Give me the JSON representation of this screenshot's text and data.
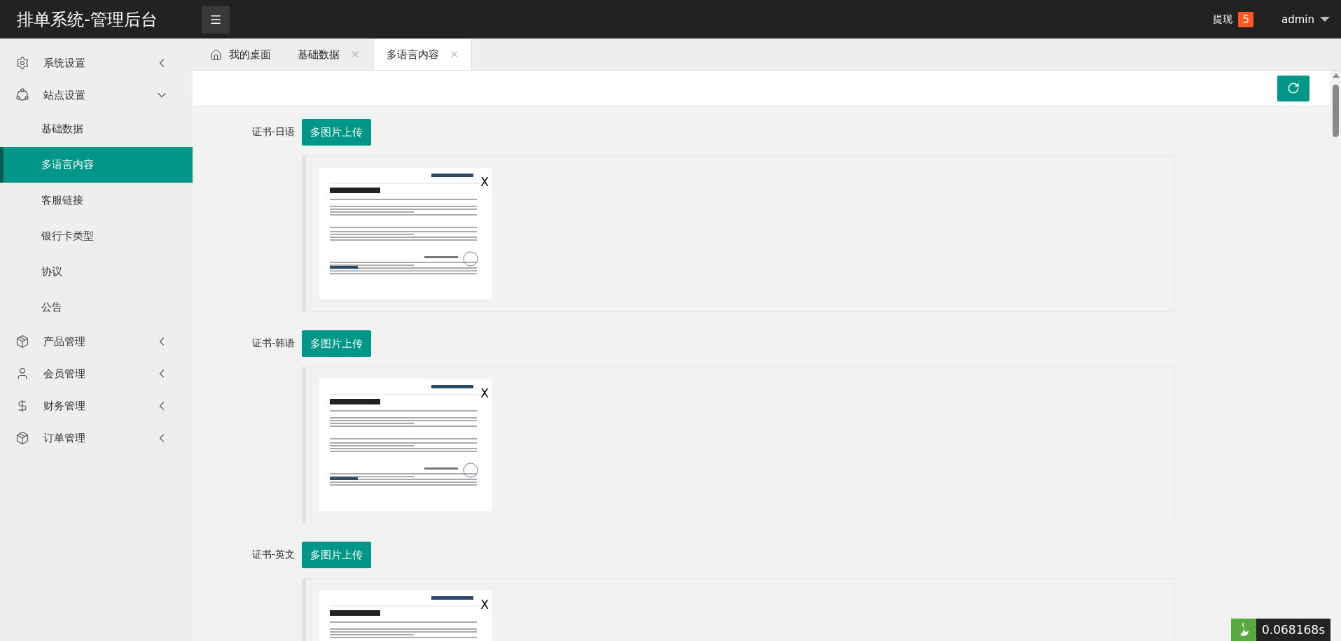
{
  "header": {
    "title": "排单系统-管理后台",
    "withdraw_label": "提现",
    "withdraw_count": "5",
    "user": "admin"
  },
  "sidebar": {
    "items": [
      {
        "label": "系统设置",
        "expanded": false
      },
      {
        "label": "站点设置",
        "expanded": true,
        "children": [
          {
            "label": "基础数据",
            "selected": false
          },
          {
            "label": "多语言内容",
            "selected": true
          },
          {
            "label": "客服链接",
            "selected": false
          },
          {
            "label": "银行卡类型",
            "selected": false
          },
          {
            "label": "协议",
            "selected": false
          },
          {
            "label": "公告",
            "selected": false
          }
        ]
      },
      {
        "label": "产品管理",
        "expanded": false
      },
      {
        "label": "会员管理",
        "expanded": false
      },
      {
        "label": "财务管理",
        "expanded": false
      },
      {
        "label": "订单管理",
        "expanded": false
      }
    ]
  },
  "tabs": [
    {
      "label": "我的桌面",
      "selected": false
    },
    {
      "label": "基础数据",
      "close": "✕",
      "selected": false
    },
    {
      "label": "多语言内容",
      "close": "✕",
      "selected": true
    }
  ],
  "sections": [
    {
      "label": "证书-日语",
      "button": "多图片上传",
      "images": [
        {
          "close": "X"
        }
      ]
    },
    {
      "label": "证书-韩语",
      "button": "多图片上传",
      "images": [
        {
          "close": "X"
        }
      ]
    },
    {
      "label": "证书-英文",
      "button": "多图片上传",
      "images": [
        {
          "close": "X"
        }
      ]
    }
  ],
  "debug_timer": "0.068168s"
}
